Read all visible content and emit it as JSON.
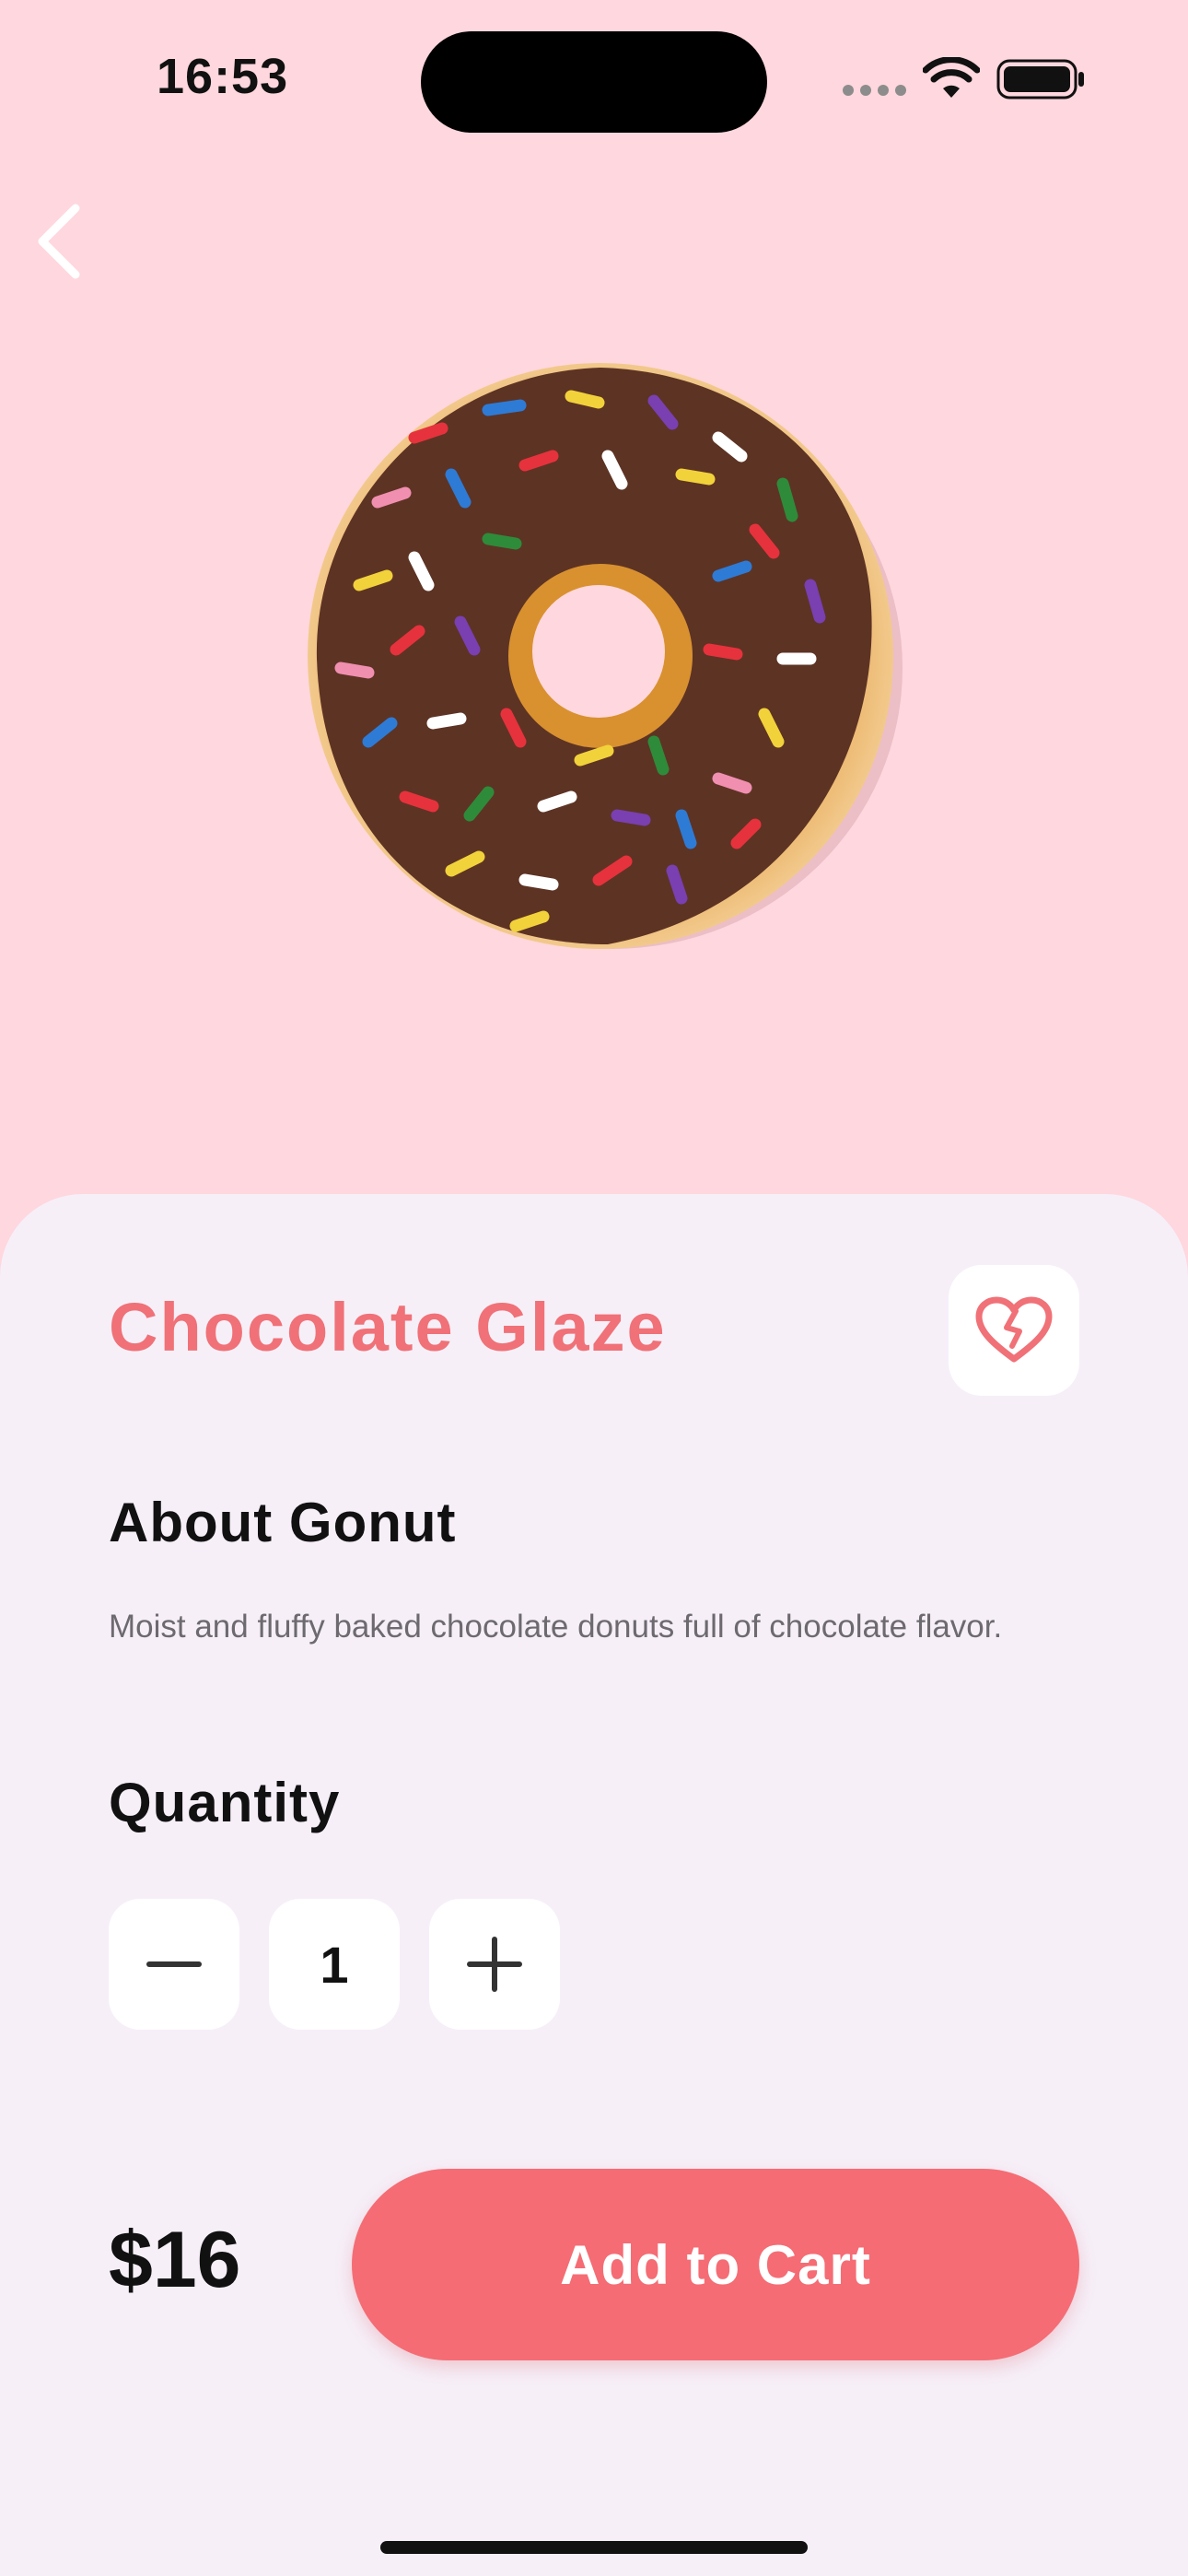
{
  "status_bar": {
    "time": "16:53"
  },
  "product": {
    "name": "Chocolate Glaze",
    "image": "chocolate-glazed-donut-with-sprinkles",
    "about_heading": "About Gonut",
    "description": "Moist and fluffy baked chocolate donuts full of chocolate flavor.",
    "quantity_heading": "Quantity",
    "quantity": "1",
    "price": "$16"
  },
  "actions": {
    "add_to_cart_label": "Add to Cart"
  },
  "icons": {
    "back": "chevron-left-icon",
    "favorite": "heart-icon",
    "decrease": "minus-icon",
    "increase": "plus-icon"
  },
  "colors": {
    "background": "#ffd7de",
    "card": "#f6eff8",
    "accent": "#f07177",
    "button": "#f56c74"
  }
}
